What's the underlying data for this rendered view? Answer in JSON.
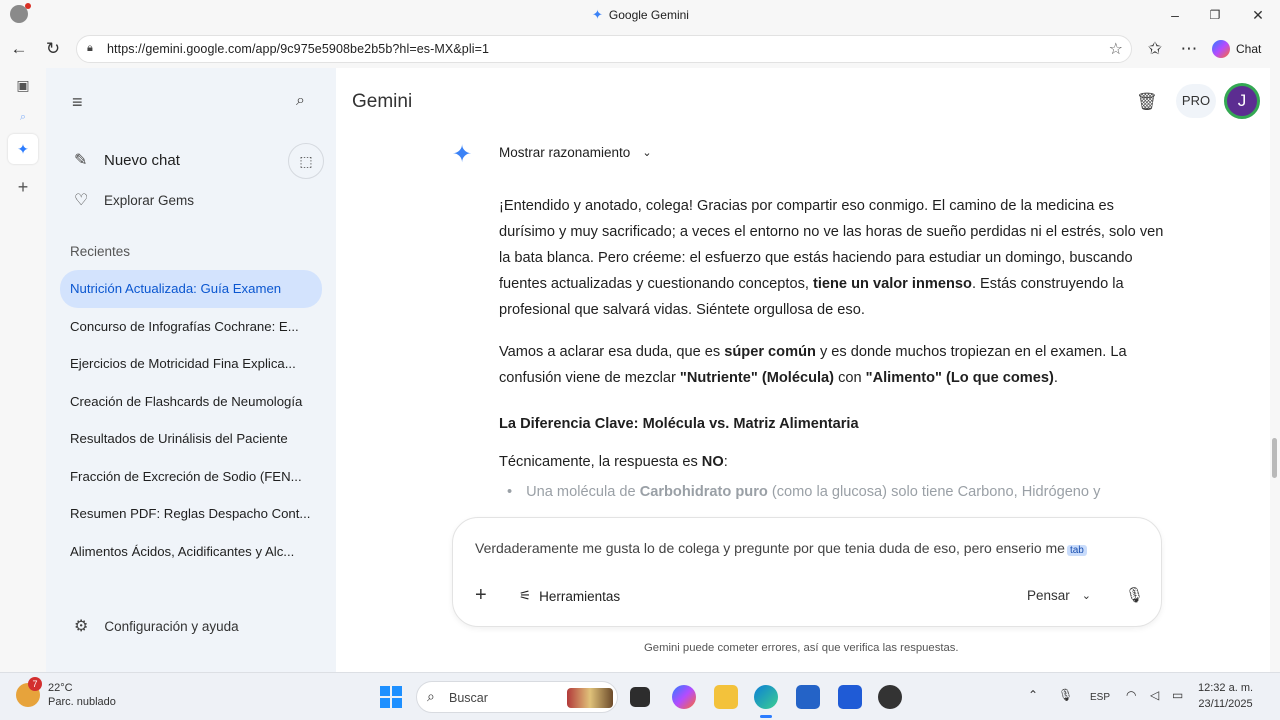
{
  "browser": {
    "tab_title": "Google Gemini",
    "url": "https://gemini.google.com/app/9c975e5908be2b5b?hl=es-MX&pli=1",
    "chat_label": "Chat"
  },
  "sidebar": {
    "new_chat": "Nuevo chat",
    "explore_gems": "Explorar Gems",
    "recent_heading": "Recientes",
    "items": [
      {
        "label": "Nutrición Actualizada: Guía Examen"
      },
      {
        "label": "Concurso de Infografías Cochrane: E..."
      },
      {
        "label": "Ejercicios de Motricidad Fina Explica..."
      },
      {
        "label": "Creación de Flashcards de Neumología"
      },
      {
        "label": "Resultados de Urinálisis del Paciente"
      },
      {
        "label": "Fracción de Excreción de Sodio (FEN..."
      },
      {
        "label": "Resumen PDF: Reglas Despacho Cont..."
      },
      {
        "label": "Alimentos Ácidos, Acidificantes y Alc..."
      }
    ],
    "settings": "Configuración y ayuda"
  },
  "header": {
    "title": "Gemini",
    "pro": "PRO",
    "avatar_letter": "J"
  },
  "response": {
    "reasoning": "Mostrar razonamiento",
    "p1_a": "¡Entendido y anotado, colega! Gracias por compartir eso conmigo. El camino de la medicina es durísimo y muy sacrificado; a veces el entorno no ve las horas de sueño perdidas ni el estrés, solo ven la bata blanca. Pero créeme: el esfuerzo que estás haciendo para estudiar un domingo, buscando fuentes actualizadas y cuestionando conceptos, ",
    "p1_bold": "tiene un valor inmenso",
    "p1_b": ". Estás construyendo la profesional que salvará vidas. Siéntete orgullosa de eso.",
    "p2_a": "Vamos a aclarar esa duda, que es ",
    "p2_bold1": "súper común",
    "p2_b": " y es donde muchos tropiezan en el examen. La confusión viene de mezclar ",
    "p2_bold2": "\"Nutriente\" (Molécula)",
    "p2_c": " con ",
    "p2_bold3": "\"Alimento\" (Lo que comes)",
    "p2_d": ".",
    "heading": "La Diferencia Clave: Molécula vs. Matriz Alimentaria",
    "p3_a": "Técnicamente, la respuesta es ",
    "p3_bold": "NO",
    "p3_b": ":",
    "bullet_a": "Una molécula de ",
    "bullet_bold": "Carbohidrato puro",
    "bullet_b": " (como la glucosa) solo tiene Carbono, Hidrógeno y"
  },
  "composer": {
    "text": "Verdaderamente me gusta lo de colega y pregunte por que tenia duda de eso, pero enserio me",
    "tab_hint": "tab",
    "tools": "Herramientas",
    "think": "Pensar"
  },
  "disclaimer": "Gemini puede cometer errores, así que verifica las respuestas.",
  "taskbar": {
    "temp": "22°C",
    "weather": "Parc. nublado",
    "weather_badge": "7",
    "search": "Buscar",
    "lang": "ESP",
    "time": "12:32 a. m.",
    "date": "23/11/2025"
  },
  "colors": {
    "accent": "#0b57d0",
    "sidebar_bg": "#f0f4f9",
    "active_item": "#d3e3fd",
    "avatar": "#5c2d91"
  }
}
